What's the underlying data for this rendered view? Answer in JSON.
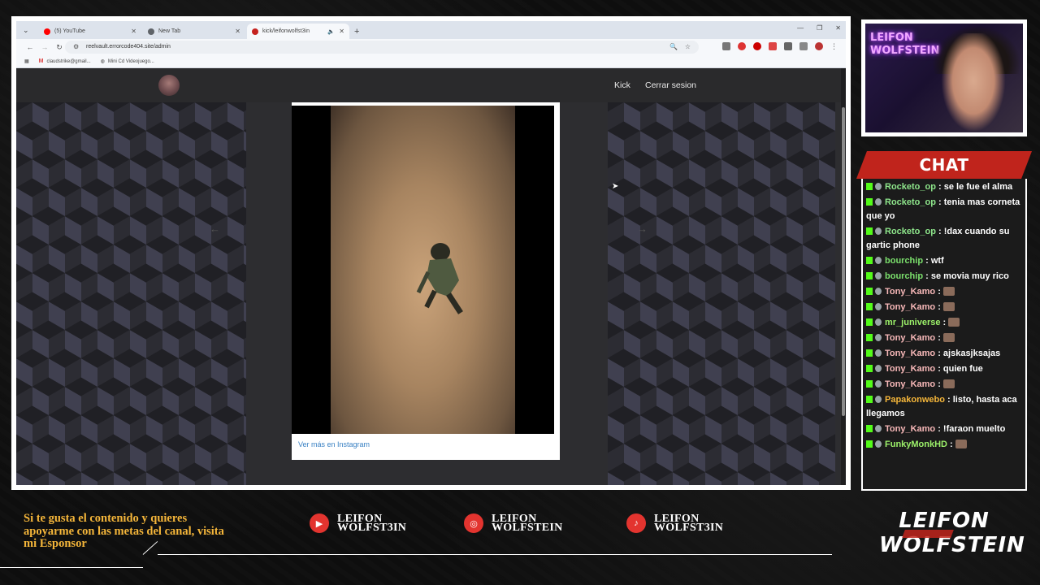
{
  "browser": {
    "tabs": [
      {
        "label": "(5) YouTube",
        "favicon_color": "#ff0000",
        "active": false
      },
      {
        "label": "New Tab",
        "favicon_color": "#5f6368",
        "active": false
      },
      {
        "label": "kick/leifonwolfst3in",
        "favicon_color": "#c5221f",
        "active": true
      }
    ],
    "url": "reelvault.errorcode404.site/admin",
    "bookmarks": [
      {
        "label": "claudstrike@gmail...",
        "icon": "gmail-icon"
      },
      {
        "label": "Mini Cd Videojuego...",
        "icon": "globe-icon"
      }
    ]
  },
  "site": {
    "nav": {
      "kick": "Kick",
      "logout": "Cerrar sesion"
    },
    "post": {
      "link": "Ver más en Instagram"
    }
  },
  "chat": {
    "title": "CHAT",
    "messages": [
      {
        "user": "Rocketo_op",
        "color": "#8ee68b",
        "text": " : se le fue el alma"
      },
      {
        "user": "Rocketo_op",
        "color": "#8ee68b",
        "text": " : tenia mas corneta que yo"
      },
      {
        "user": "Rocketo_op",
        "color": "#8ee68b",
        "text": " : !dax cuando su gartic phone"
      },
      {
        "user": "bourchip",
        "color": "#7be06c",
        "text": " : wtf"
      },
      {
        "user": "bourchip",
        "color": "#7be06c",
        "text": " : se movia muy rico"
      },
      {
        "user": "Tony_Kamo",
        "color": "#f7b8b8",
        "text": " : ",
        "emote": true
      },
      {
        "user": "Tony_Kamo",
        "color": "#f7b8b8",
        "text": " : ",
        "emote": true
      },
      {
        "user": "mr_juniverse",
        "color": "#9df26a",
        "text": " : ",
        "emote": true
      },
      {
        "user": "Tony_Kamo",
        "color": "#f7b8b8",
        "text": " : ",
        "emote": true
      },
      {
        "user": "Tony_Kamo",
        "color": "#f7b8b8",
        "text": " : ajskasjksajas"
      },
      {
        "user": "Tony_Kamo",
        "color": "#f7b8b8",
        "text": " : quien fue"
      },
      {
        "user": "Tony_Kamo",
        "color": "#f7b8b8",
        "text": " : ",
        "emote": true
      },
      {
        "user": "Papakonwebo",
        "color": "#f5b63a",
        "text": " : listo, hasta aca llegamos"
      },
      {
        "user": "Tony_Kamo",
        "color": "#f7b8b8",
        "text": " : !faraon muelto"
      },
      {
        "user": "FunkyMonkHD",
        "color": "#9df26a",
        "text": " : ",
        "emote": true
      }
    ]
  },
  "overlay": {
    "sponsor_text": "Si te gusta el contenido y quieres apoyarme con las metas del canal, visita mi Esponsor",
    "socials": [
      {
        "platform": "youtube",
        "icon": "youtube-icon",
        "line1": "LEIFON",
        "line2": "WOLFST3IN"
      },
      {
        "platform": "instagram",
        "icon": "instagram-icon",
        "line1": "LEIFON",
        "line2": "WOLFSTEIN"
      },
      {
        "platform": "tiktok",
        "icon": "tiktok-icon",
        "line1": "LEIFON",
        "line2": "WOLFST3IN"
      }
    ],
    "logo": {
      "line1": "LEIFON",
      "line2": "WOLFSTEIN"
    },
    "cam_sign": "LEIFON WOLFSTEIN"
  }
}
